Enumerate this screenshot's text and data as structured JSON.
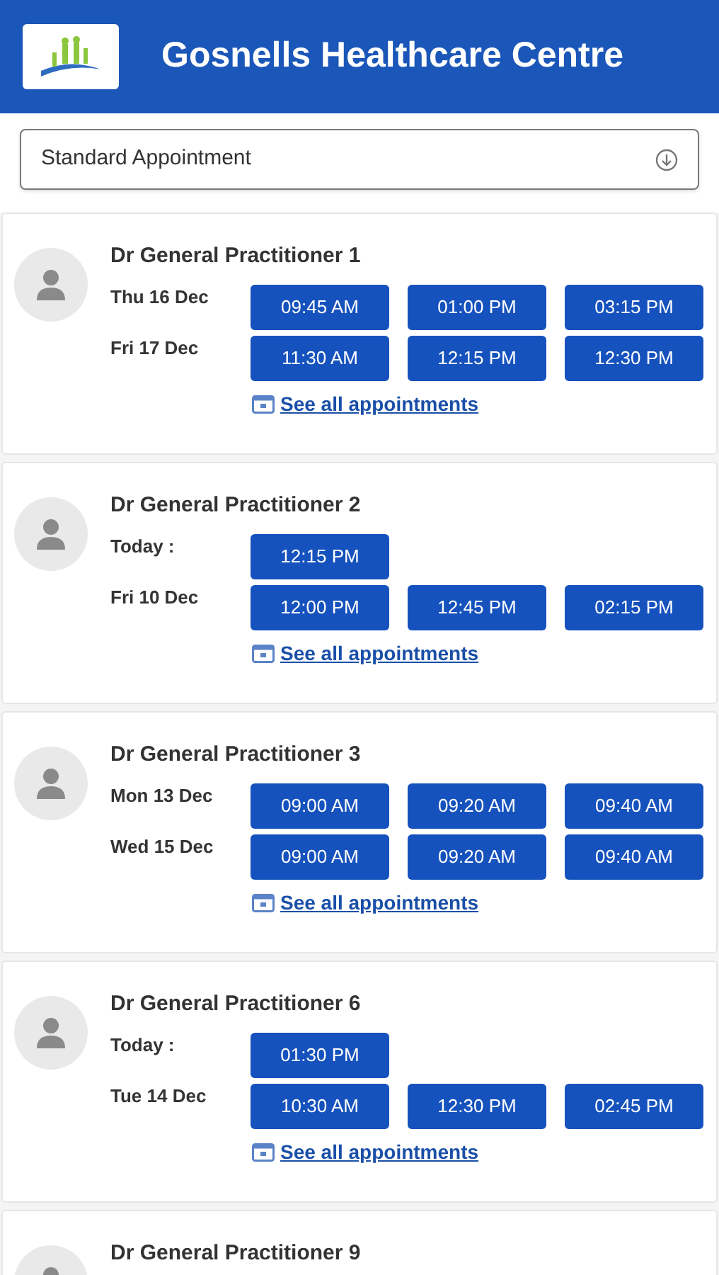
{
  "header": {
    "title": "Gosnells Healthcare Centre"
  },
  "appointment_type": {
    "value": "Standard Appointment"
  },
  "practitioners": [
    {
      "name": "Dr General Practitioner 1",
      "days": [
        {
          "label": "Thu 16 Dec",
          "slots": [
            "09:45 AM",
            "01:00 PM",
            "03:15 PM"
          ]
        },
        {
          "label": "Fri 17 Dec",
          "slots": [
            "11:30 AM",
            "12:15 PM",
            "12:30 PM"
          ]
        }
      ],
      "link": "See all appointments"
    },
    {
      "name": "Dr General Practitioner 2",
      "days": [
        {
          "label": "Today :",
          "slots": [
            "12:15 PM"
          ]
        },
        {
          "label": "Fri 10 Dec",
          "slots": [
            "12:00 PM",
            "12:45 PM",
            "02:15 PM"
          ]
        }
      ],
      "link": "See all appointments"
    },
    {
      "name": "Dr General Practitioner 3",
      "days": [
        {
          "label": "Mon 13 Dec",
          "slots": [
            "09:00 AM",
            "09:20 AM",
            "09:40 AM"
          ]
        },
        {
          "label": "Wed 15 Dec",
          "slots": [
            "09:00 AM",
            "09:20 AM",
            "09:40 AM"
          ]
        }
      ],
      "link": "See all appointments"
    },
    {
      "name": "Dr General Practitioner 6",
      "days": [
        {
          "label": "Today :",
          "slots": [
            "01:30 PM"
          ]
        },
        {
          "label": "Tue 14 Dec",
          "slots": [
            "10:30 AM",
            "12:30 PM",
            "02:45 PM"
          ]
        }
      ],
      "link": "See all appointments"
    },
    {
      "name": "Dr General Practitioner 9"
    }
  ]
}
